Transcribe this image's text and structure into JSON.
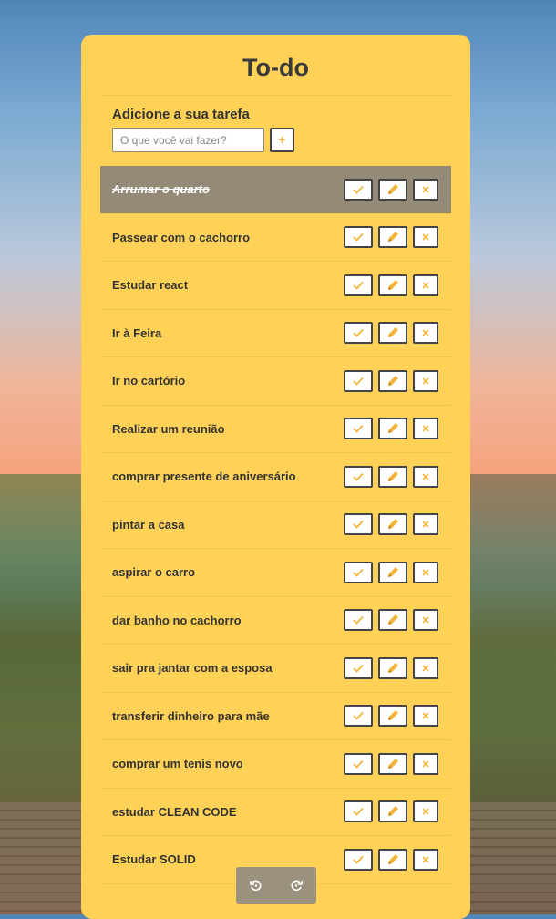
{
  "app": {
    "title": "To-do"
  },
  "add": {
    "label": "Adicione a sua tarefa",
    "placeholder": "O que você vai fazer?",
    "button": "+"
  },
  "todos": [
    {
      "text": "Arrumar o quarto",
      "done": true
    },
    {
      "text": "Passear com o cachorro",
      "done": false
    },
    {
      "text": "Estudar react",
      "done": false
    },
    {
      "text": "Ir à Feira",
      "done": false
    },
    {
      "text": "Ir no cartório",
      "done": false
    },
    {
      "text": "Realizar um reunião",
      "done": false
    },
    {
      "text": "comprar presente de aniversário",
      "done": false
    },
    {
      "text": "pintar a casa",
      "done": false
    },
    {
      "text": "aspirar o carro",
      "done": false
    },
    {
      "text": "dar banho no cachorro",
      "done": false
    },
    {
      "text": "sair pra jantar com a esposa",
      "done": false
    },
    {
      "text": "transferir dinheiro para mãe",
      "done": false
    },
    {
      "text": "comprar um tenis novo",
      "done": false
    },
    {
      "text": "estudar CLEAN CODE",
      "done": false
    },
    {
      "text": "Estudar SOLID",
      "done": false
    }
  ],
  "icons": {
    "complete": "check-icon",
    "edit": "pencil-icon",
    "delete": "close-icon",
    "undo": "undo-icon",
    "redo": "redo-icon"
  },
  "colors": {
    "card": "#ffd257",
    "accent": "#f4b43a",
    "done_row": "#948a77"
  }
}
